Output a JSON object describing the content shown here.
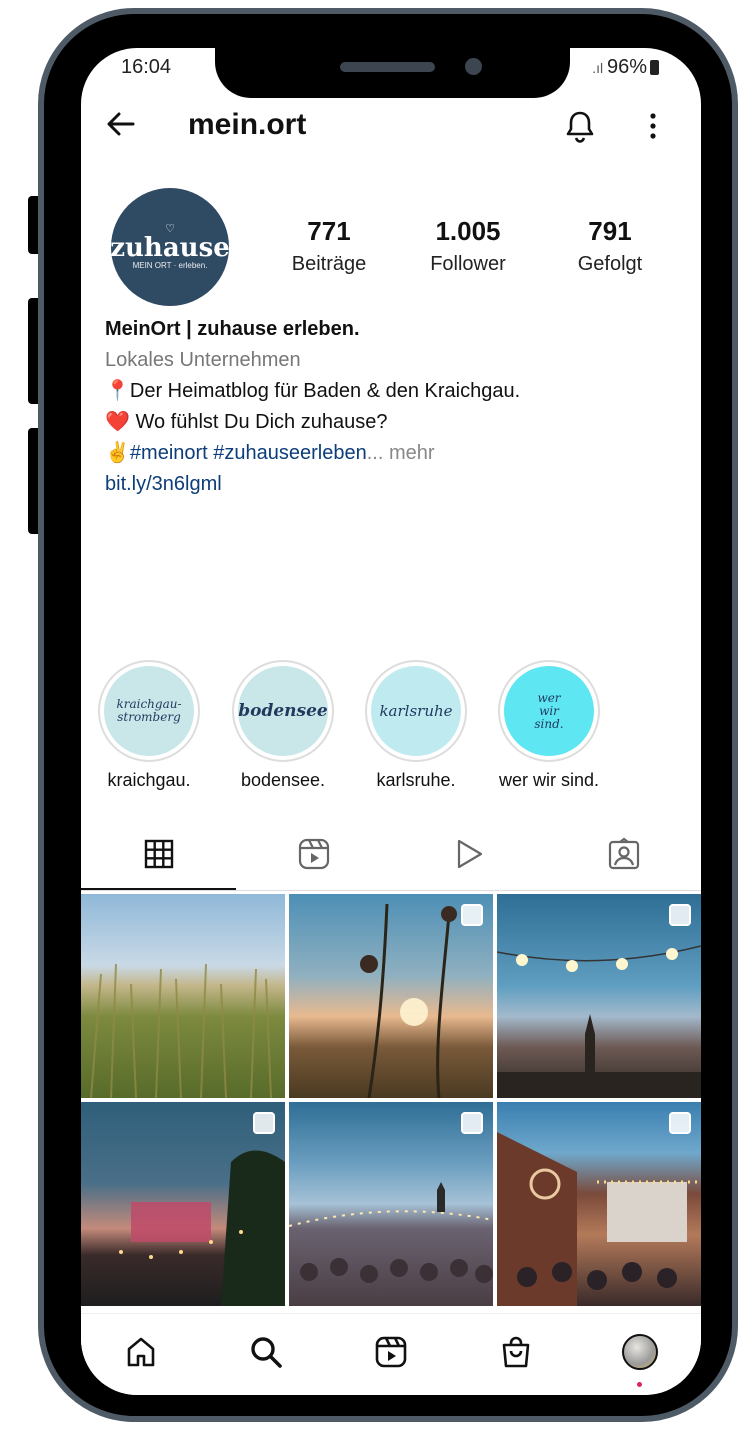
{
  "status_bar": {
    "time": "16:04",
    "battery": "96%"
  },
  "header": {
    "username": "mein.ort",
    "back_icon": "arrow-left-icon",
    "bell_icon": "bell-icon",
    "more_icon": "more-vertical-icon"
  },
  "profile": {
    "avatar": {
      "logo_text": "zuhause",
      "logo_sub": "MEIN ORT · erleben.",
      "color": "#2f4a63"
    },
    "stats": [
      {
        "value": "771",
        "label": "Beiträge"
      },
      {
        "value": "1.005",
        "label": "Follower"
      },
      {
        "value": "791",
        "label": "Gefolgt"
      }
    ],
    "name": "MeinOrt | zuhause erleben.",
    "category": "Lokales Unternehmen",
    "bio_line1": "📍Der Heimatblog für Baden & den Kraichgau.",
    "bio_line2": "❤️ Wo fühlst Du Dich zuhause?",
    "bio_line3_emoji": "✌️",
    "bio_line3_tags": "#meinort #zuhauseerleben",
    "bio_line3_more": "... mehr",
    "link": "bit.ly/3n6lgml"
  },
  "highlights": [
    {
      "cover_text": "kraichgau-stromberg",
      "label": "kraichgau.",
      "color": "#c9e6e8"
    },
    {
      "cover_text": "bodensee",
      "label": "bodensee.",
      "color": "#c9e6e8"
    },
    {
      "cover_text": "karlsruhe",
      "label": "karlsruhe.",
      "color": "#bfeaf0"
    },
    {
      "cover_text": "wer wir sind.",
      "label": "wer wir sind.",
      "color": "#5ee6f2"
    }
  ],
  "tabs": [
    {
      "icon": "grid-icon",
      "active": true
    },
    {
      "icon": "reels-icon",
      "active": false
    },
    {
      "icon": "play-icon",
      "active": false
    },
    {
      "icon": "tagged-user-icon",
      "active": false
    }
  ],
  "posts": [
    {
      "desc": "cornfield-under-sky",
      "multi": false
    },
    {
      "desc": "flower-at-sunset",
      "multi": true
    },
    {
      "desc": "string-lights-church-dusk",
      "multi": true
    },
    {
      "desc": "concert-stage-night",
      "multi": true
    },
    {
      "desc": "festival-crowd-evening",
      "multi": true
    },
    {
      "desc": "courtyard-party",
      "multi": true
    }
  ],
  "bottom_nav": [
    {
      "icon": "home-icon"
    },
    {
      "icon": "search-icon"
    },
    {
      "icon": "reels-icon"
    },
    {
      "icon": "shop-icon"
    },
    {
      "icon": "profile-avatar-icon"
    }
  ]
}
